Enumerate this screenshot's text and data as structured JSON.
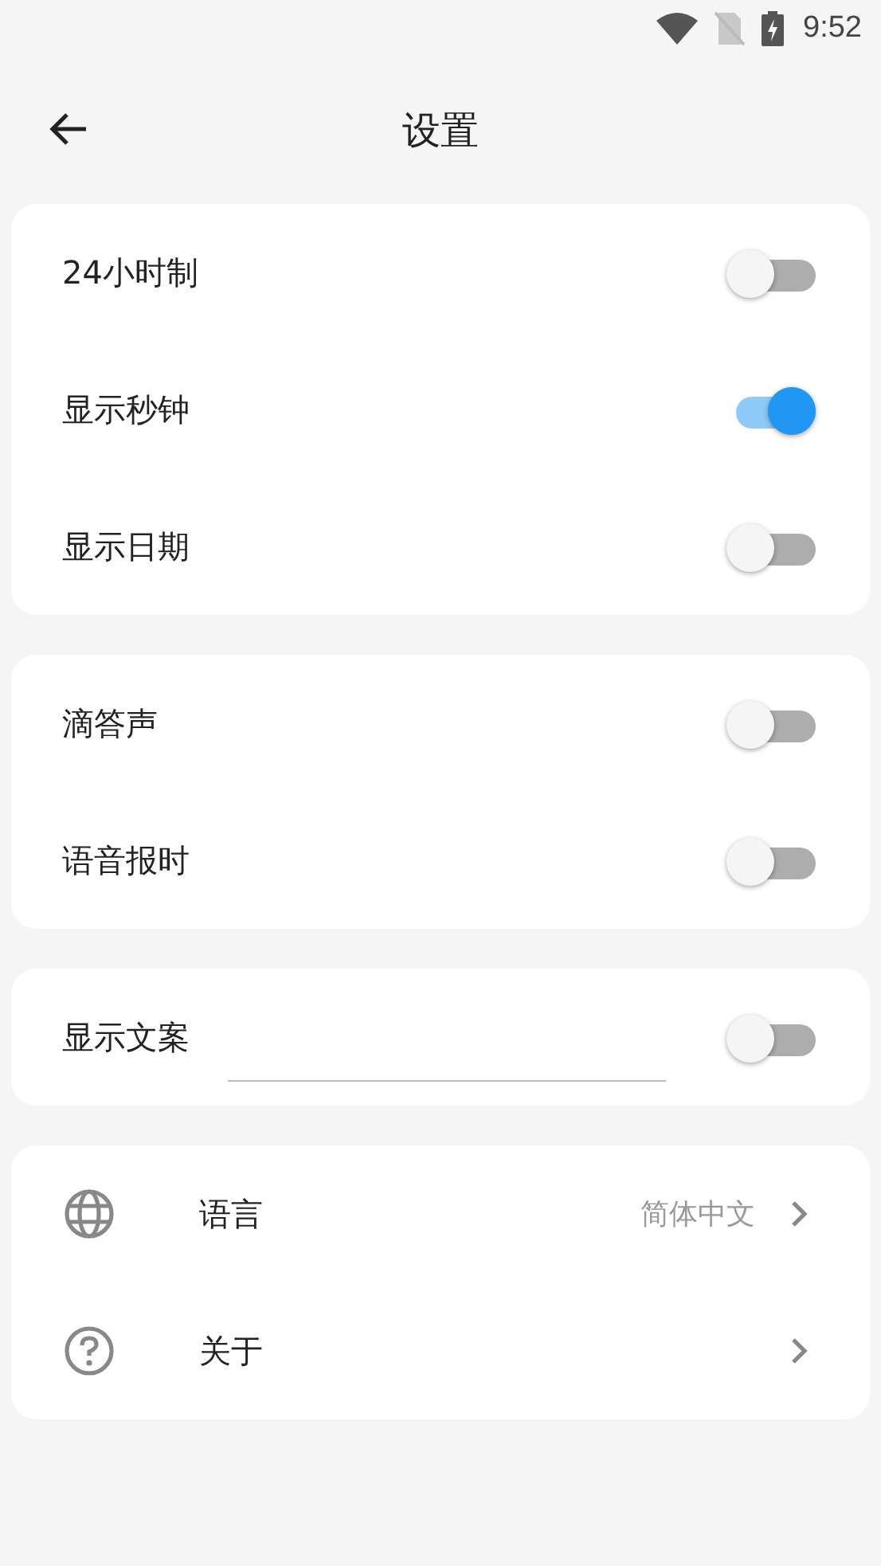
{
  "status_bar": {
    "time": "9:52"
  },
  "header": {
    "title": "设置"
  },
  "sections": [
    {
      "rows": [
        {
          "kind": "toggle",
          "label": "24小时制",
          "on": false
        },
        {
          "kind": "toggle",
          "label": "显示秒钟",
          "on": true
        },
        {
          "kind": "toggle",
          "label": "显示日期",
          "on": false
        }
      ]
    },
    {
      "rows": [
        {
          "kind": "toggle",
          "label": "滴答声",
          "on": false
        },
        {
          "kind": "toggle",
          "label": "语音报时",
          "on": false
        }
      ]
    },
    {
      "rows": [
        {
          "kind": "field_toggle",
          "label": "显示文案",
          "on": false
        }
      ]
    },
    {
      "rows": [
        {
          "kind": "link",
          "label": "语言",
          "value": "简体中文"
        },
        {
          "kind": "link",
          "label": "关于"
        }
      ]
    }
  ]
}
